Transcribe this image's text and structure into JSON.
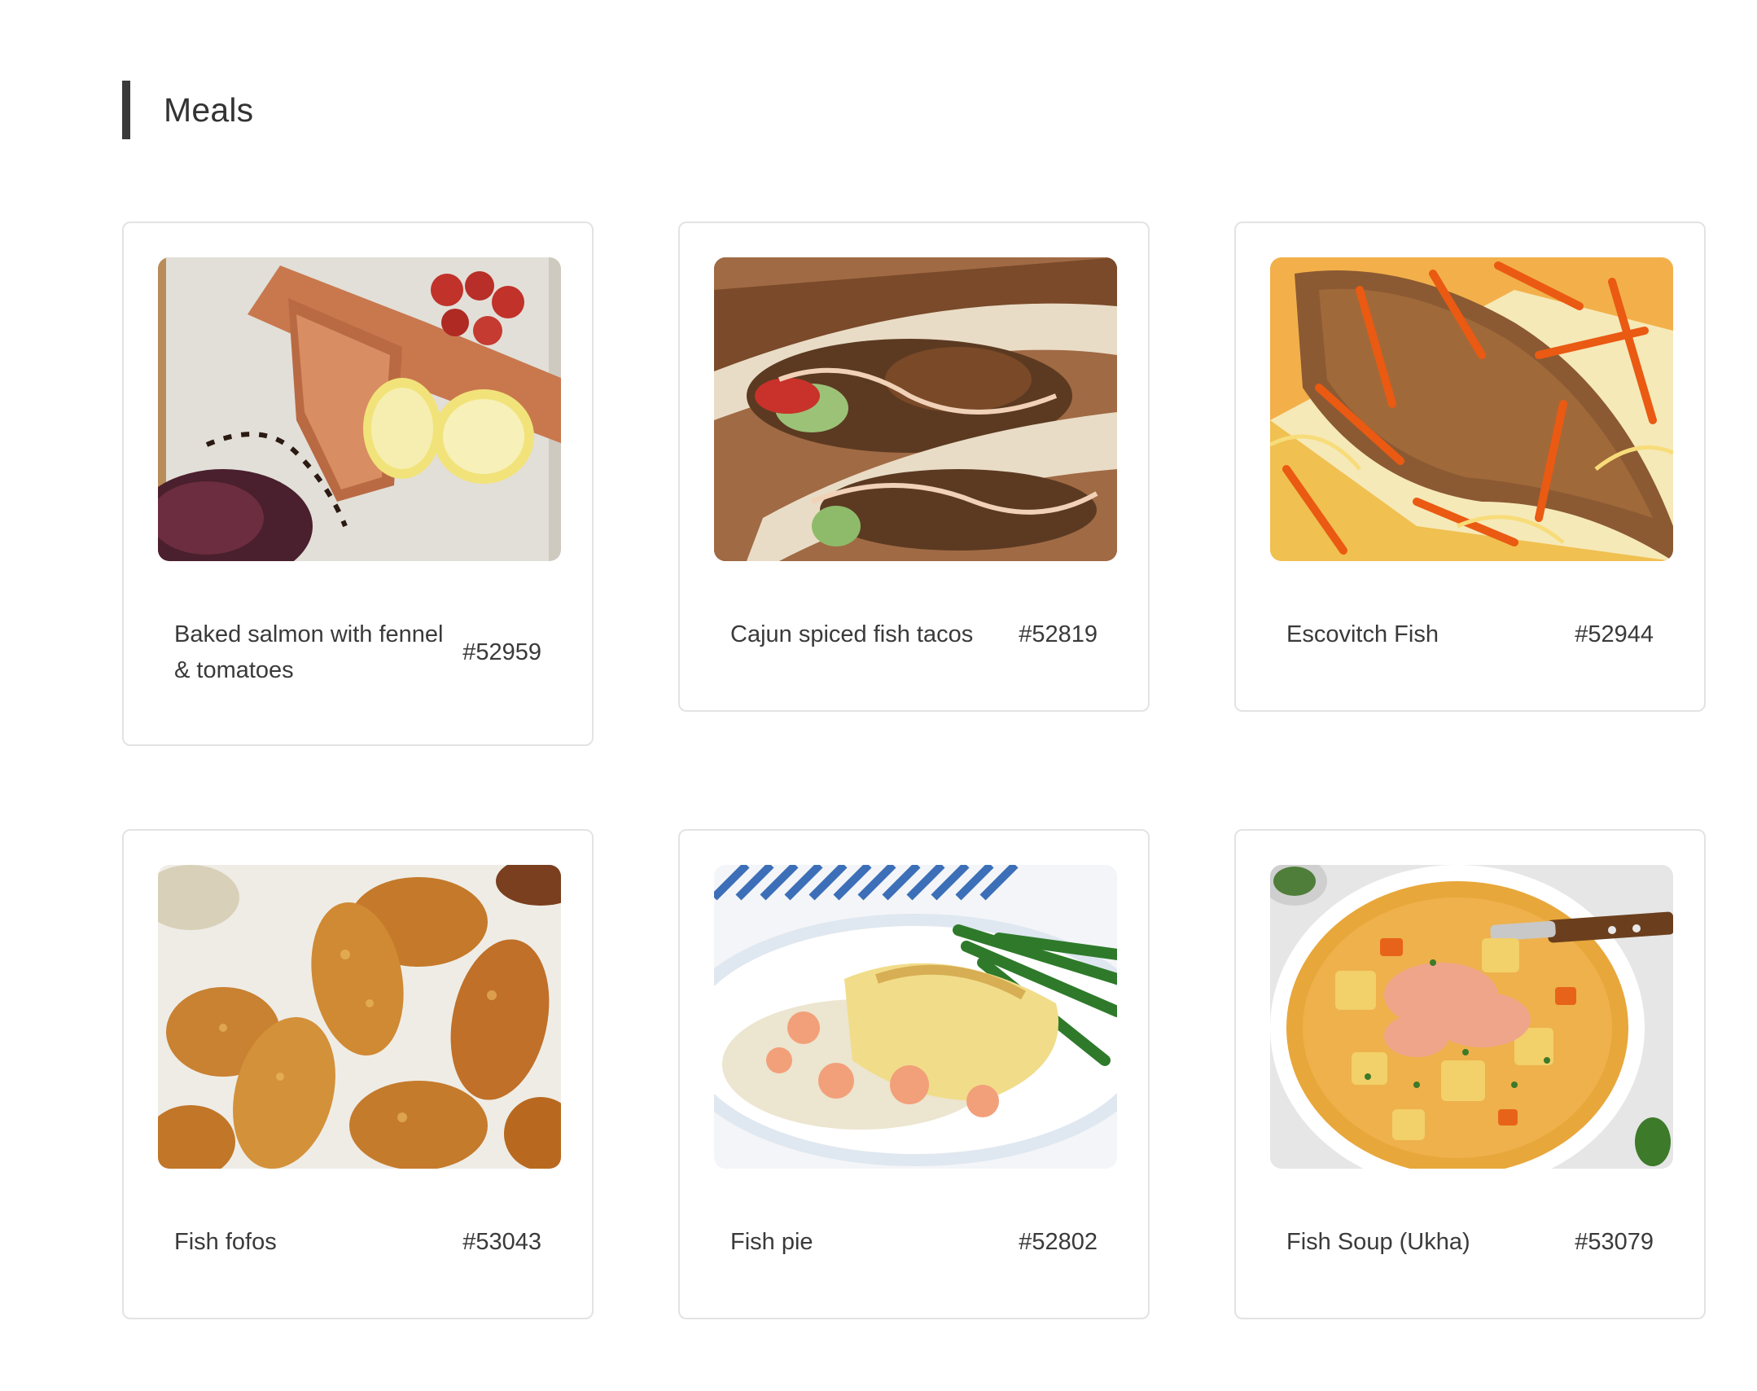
{
  "section": {
    "title": "Meals"
  },
  "meals": [
    {
      "name": "Baked salmon with fennel & tomatoes",
      "id": "#52959",
      "image_icon": "baked-salmon-photo"
    },
    {
      "name": "Cajun spiced fish tacos",
      "id": "#52819",
      "image_icon": "fish-tacos-photo"
    },
    {
      "name": "Escovitch Fish",
      "id": "#52944",
      "image_icon": "escovitch-fish-photo"
    },
    {
      "name": "Fish fofos",
      "id": "#53043",
      "image_icon": "fish-fofos-photo"
    },
    {
      "name": "Fish pie",
      "id": "#52802",
      "image_icon": "fish-pie-photo"
    },
    {
      "name": "Fish Soup (Ukha)",
      "id": "#53079",
      "image_icon": "fish-soup-photo"
    }
  ],
  "colors": {
    "accent_bar": "#3a3a3a",
    "card_border": "#e3e3e3",
    "text": "#3a3a3a"
  }
}
